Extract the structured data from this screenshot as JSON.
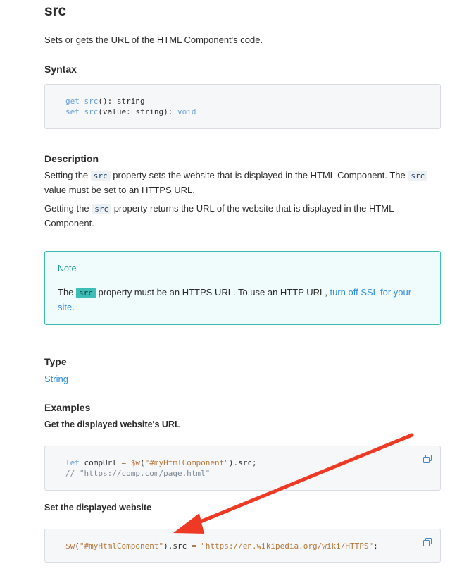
{
  "title": "src",
  "summary": "Sets or gets the URL of the HTML Component's code.",
  "syntax": {
    "heading": "Syntax",
    "line1": {
      "kw": "get",
      "fn": "src",
      "rest": "(): ",
      "type": "string"
    },
    "line2": {
      "kw": "set",
      "fn": "src",
      "p1": "(value: ",
      "type": "string",
      "p2": "): ",
      "ret": "void"
    }
  },
  "description": {
    "heading": "Description",
    "p1_a": "Setting the ",
    "p1_code": "src",
    "p1_b": " property sets the website that is displayed in the HTML Component. The ",
    "p1_code2": "src",
    "p1_c": " value must be set to an HTTPS URL.",
    "p2_a": "Getting the ",
    "p2_code": "src",
    "p2_b": " property returns the URL of the website that is displayed in the HTML Component."
  },
  "note": {
    "title": "Note",
    "text_a": "The ",
    "code": "src",
    "text_b": " property must be an HTTPS URL. To use an HTTP URL, ",
    "link": "turn off SSL for your site",
    "text_c": "."
  },
  "type": {
    "heading": "Type",
    "value": "String"
  },
  "examples": {
    "heading": "Examples",
    "ex1": {
      "title": "Get the displayed website's URL",
      "let": "let",
      "var": " compUrl ",
      "eq": "=",
      "dollar": "$w",
      "open": "(",
      "arg": "\"#myHtmlComponent\"",
      "close": ").src;",
      "comment": "// \"https://comp.com/page.html\""
    },
    "ex2": {
      "title": "Set the displayed website",
      "dollar": "$w",
      "open": "(",
      "arg": "\"#myHtmlComponent\"",
      "mid": ").src ",
      "eq": "=",
      "sp": " ",
      "val": "\"https://en.wikipedia.org/wiki/HTTPS\"",
      "end": ";"
    }
  },
  "colors": {
    "accent": "#3bbcb4",
    "link": "#2f8fdc",
    "arrow": "#ee3a24"
  },
  "icons": {
    "copy": "copy-icon",
    "arrow": "annotation-arrow"
  }
}
